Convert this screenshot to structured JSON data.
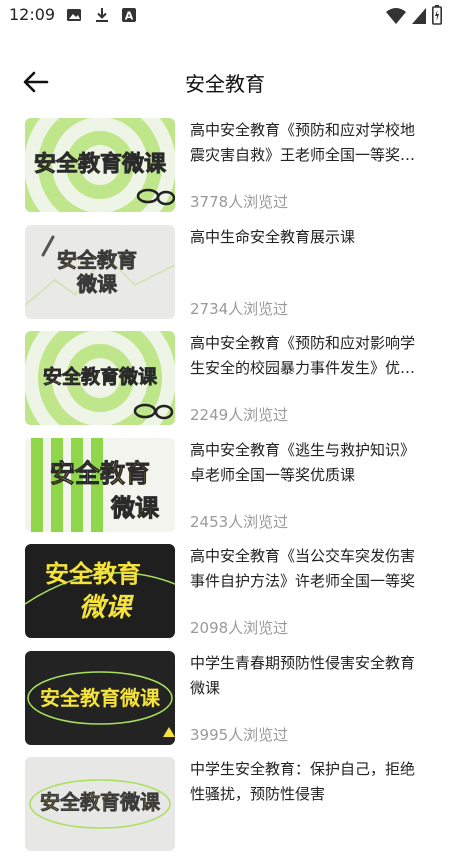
{
  "status": {
    "time": "12:09",
    "icons": [
      "image-icon",
      "download-icon",
      "a-badge-icon",
      "wifi-icon",
      "battery-icon"
    ]
  },
  "appbar": {
    "title": "安全教育",
    "back_icon": "arrow-left-icon"
  },
  "items": [
    {
      "title": "高中安全教育《预防和应对学校地震灾害自救》王老师全国一等奖优质课",
      "views": "3778人浏览过",
      "thumb_text": "安全教育微课",
      "thumb_style": "green-swirl"
    },
    {
      "title": "高中生命安全教育展示课",
      "views": "2734人浏览过",
      "thumb_text": "安全教育微课",
      "thumb_style": "grey"
    },
    {
      "title": "高中安全教育《预防和应对影响学生安全的校园暴力事件发生》优质课",
      "views": "2249人浏览过",
      "thumb_text": "安全教育微课",
      "thumb_style": "green-swirl"
    },
    {
      "title": "高中安全教育《逃生与救护知识》卓老师全国一等奖优质课",
      "views": "2453人浏览过",
      "thumb_text": "安全教育微课",
      "thumb_style": "stripes"
    },
    {
      "title": "高中安全教育《当公交车突发伤害事件自护方法》许老师全国一等奖",
      "views": "2098人浏览过",
      "thumb_text": "安全教育微课",
      "thumb_style": "dark"
    },
    {
      "title": "中学生青春期预防性侵害安全教育微课",
      "views": "3995人浏览过",
      "thumb_text": "安全教育微课",
      "thumb_style": "dark"
    },
    {
      "title": "中学生安全教育：保护自己，拒绝性骚扰，预防性侵害",
      "views": "",
      "thumb_text": "安全教育微课",
      "thumb_style": "grey"
    }
  ],
  "colors": {
    "accent_yellow": "#f5e33a",
    "accent_green": "#a9e05a",
    "dark": "#1f1f1f"
  }
}
